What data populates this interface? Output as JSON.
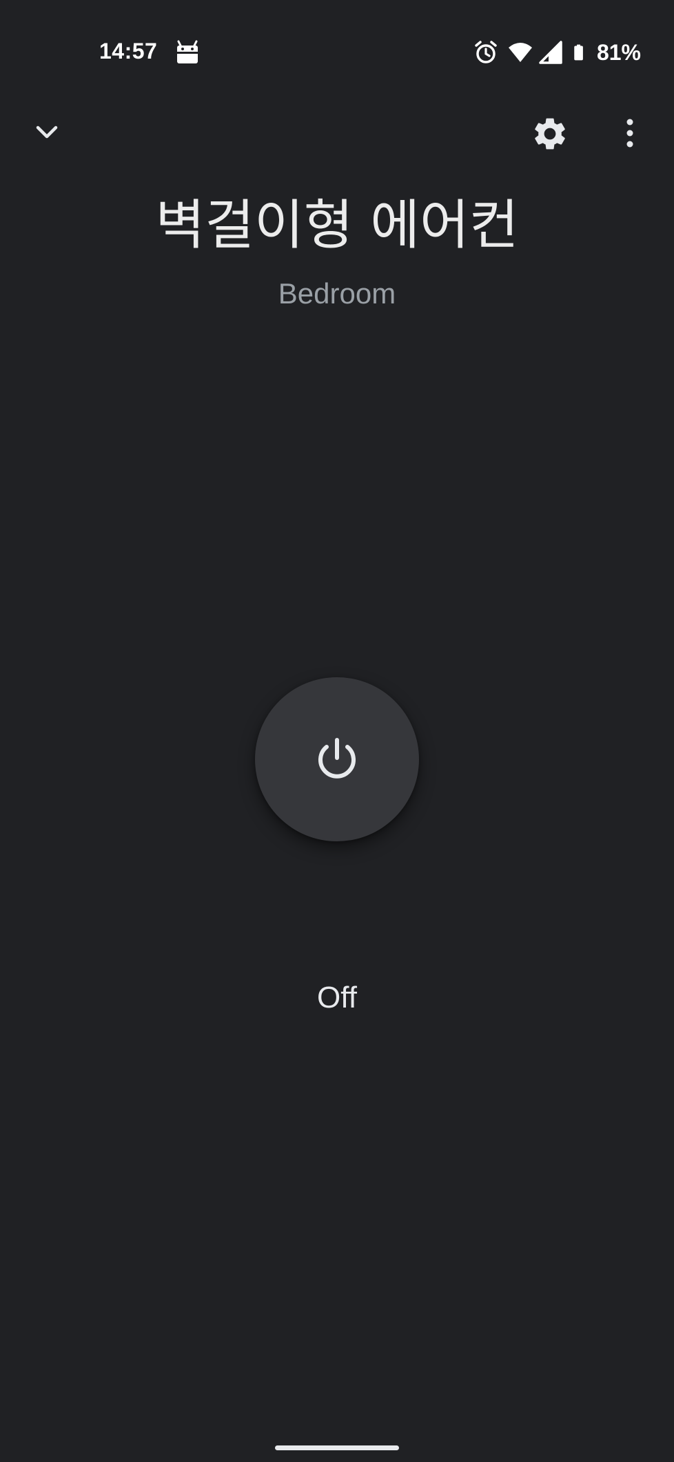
{
  "status_bar": {
    "time": "14:57",
    "battery_percent": "81%",
    "icons": [
      "android-notification-icon",
      "alarm-icon",
      "wifi-icon",
      "cell-signal-icon",
      "battery-icon"
    ]
  },
  "toolbar": {
    "collapse_icon": "chevron-down-icon",
    "settings_icon": "gear-icon",
    "more_icon": "more-vert-icon"
  },
  "device": {
    "name": "벽걸이형 에어컨",
    "room": "Bedroom",
    "power_state": "Off",
    "power_icon": "power-icon"
  },
  "colors": {
    "background": "#202124",
    "power_button": "#36373b",
    "title_text": "#ececec",
    "subtitle_text": "#9aa0a6"
  }
}
